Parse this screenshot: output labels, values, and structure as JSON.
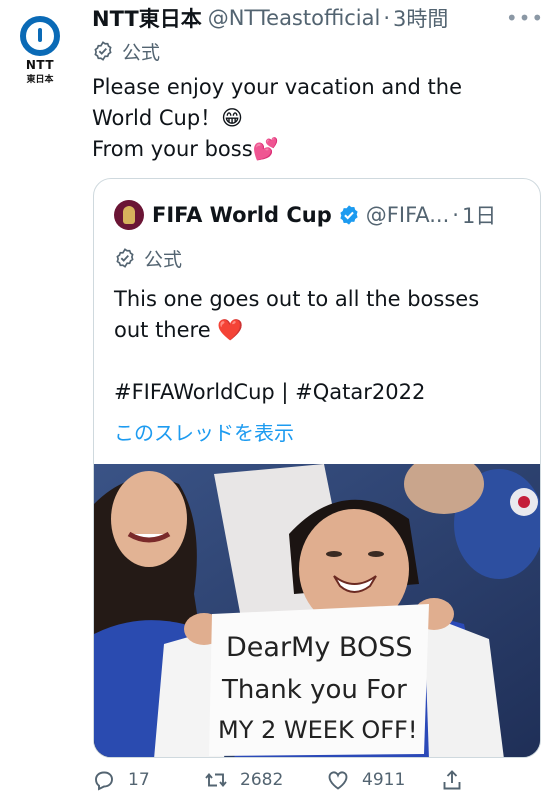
{
  "author": {
    "display_name": "NTT東日本",
    "handle": "@NTTeastofficial",
    "time": "3時間",
    "official_label": "公式",
    "avatar_logo_text": "NTT",
    "avatar_logo_subtext": "東日本"
  },
  "tweet": {
    "lines": [
      "Please enjoy your vacation and the",
      "World Cup！😁",
      "From your boss💕"
    ]
  },
  "quote": {
    "display_name": "FIFA World Cup",
    "handle": "@FIFA...",
    "time": "1日",
    "official_label": "公式",
    "lines": [
      "This one goes out to all the bosses",
      "out there ❤️",
      "",
      "#FIFAWorldCup | #Qatar2022"
    ],
    "thread_link": "このスレッドを表示",
    "photo_sign_lines": [
      "DearMy BOSS",
      "Thank you For",
      "MY 2 WEEK OFF!"
    ]
  },
  "actions": {
    "replies": "17",
    "retweets": "2682",
    "likes": "4911"
  },
  "colors": {
    "link": "#1d9bf0",
    "secondary_text": "#536471",
    "verified": "#1d9bf0",
    "ntt_blue": "#0a6ab6"
  }
}
